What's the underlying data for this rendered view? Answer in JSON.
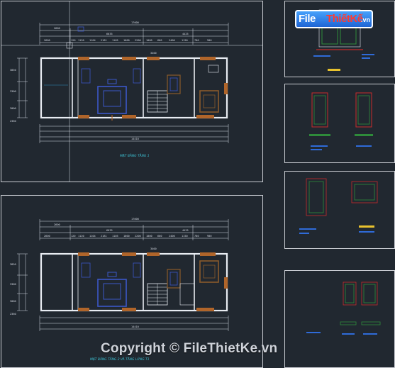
{
  "sheets": {
    "plan_1": {
      "title": "MẶT BẰNG TẦNG 1",
      "overall_top": "17000",
      "overall_bottom": "14410",
      "dim_top_left": "2600",
      "dim_top_mid": "6035",
      "dim_top_right": "4425",
      "dim_stair": "3400",
      "dims_row": [
        "2600",
        "120",
        "1120",
        "1104",
        "2181",
        "1105",
        "1000",
        "2200",
        "1000",
        "600",
        "2400",
        "1150",
        "780",
        "900"
      ],
      "side_dims": [
        "3850",
        "3300",
        "3000",
        "2360"
      ]
    },
    "plan_2": {
      "title": "MẶT BẰNG TẦNG 2 VÀ TẦNG LỬNG T1",
      "overall_top": "17000",
      "overall_bottom": "14410",
      "dim_top_left": "2600",
      "dim_top_mid": "6035",
      "dim_top_right": "4425",
      "dim_stair": "3400",
      "dims_row": [
        "2600",
        "120",
        "1120",
        "1104",
        "2181",
        "1105",
        "1000",
        "2200",
        "1000",
        "600",
        "2400",
        "1150",
        "780",
        "900"
      ],
      "side_dims": [
        "3850",
        "3300",
        "3000",
        "2360"
      ]
    }
  },
  "colors": {
    "background": "#212830",
    "sheet_border": "#c9ccd2",
    "wall": "#e8ecf2",
    "furniture": "#3b57c9",
    "door": "#b0652a",
    "wood": "#8a5a2b",
    "green_wall": "#2e8b3a",
    "red_frame": "#c72b2b",
    "title": "#3ec7d9",
    "legend": "#2f6bd8"
  },
  "watermark": {
    "logo_file": "File",
    "logo_rest": "ThiếtKế",
    "logo_suffix": ".vn",
    "copyright": "Copyright © FileThietKe.vn"
  }
}
